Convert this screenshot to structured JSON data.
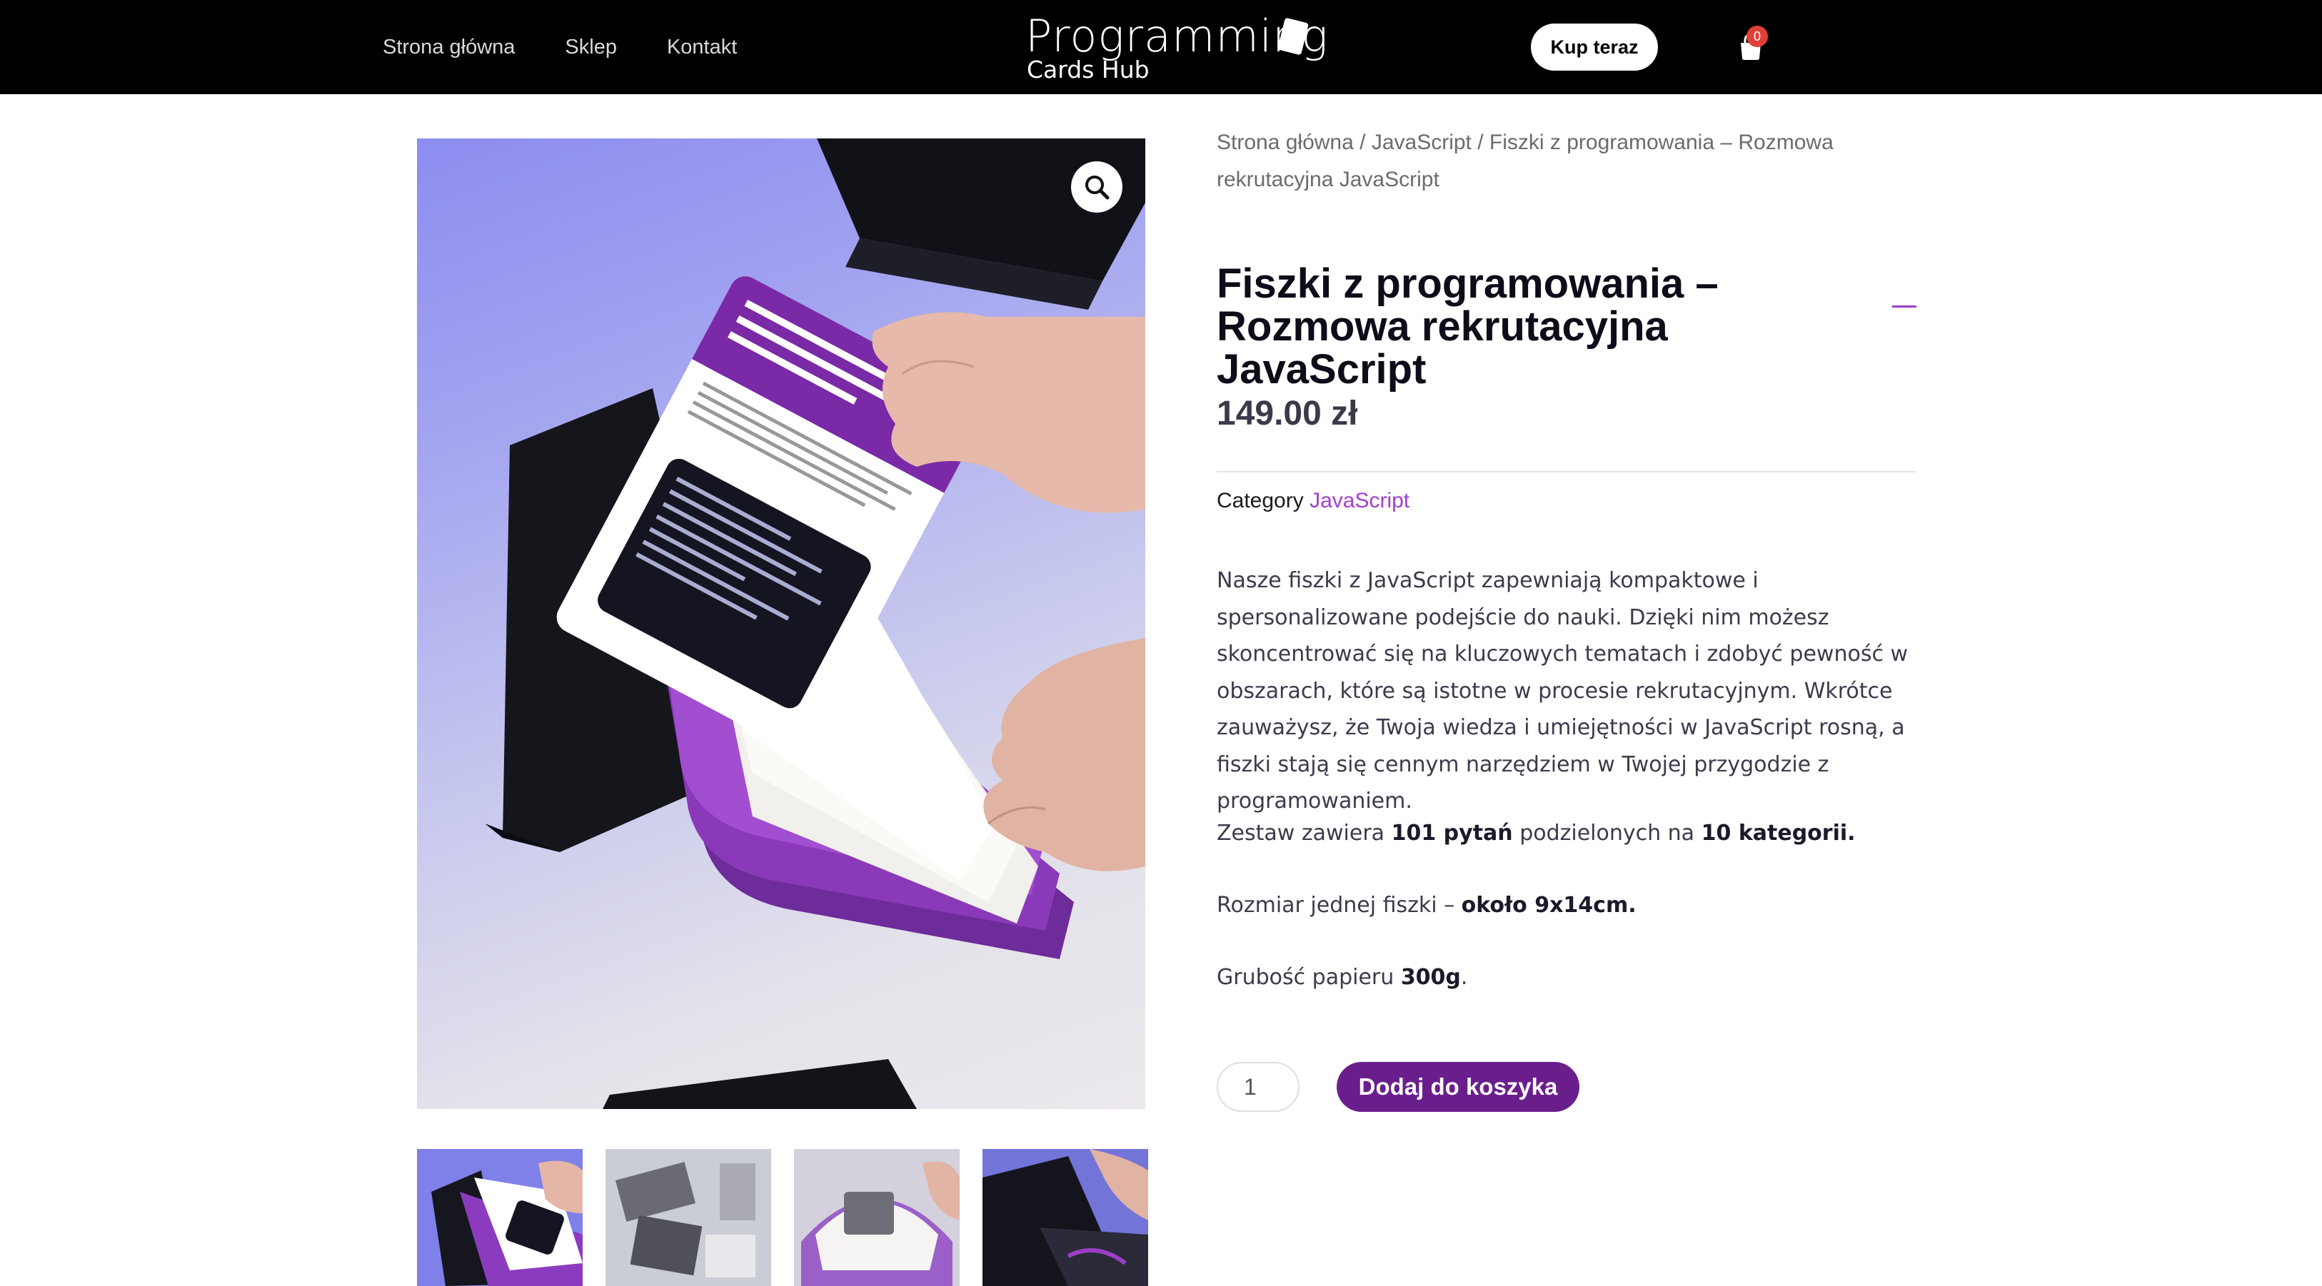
{
  "header": {
    "nav": [
      "Strona główna",
      "Sklep",
      "Kontakt"
    ],
    "logo": {
      "line1": "Programming",
      "line2": "Cards Hub"
    },
    "buy_label": "Kup teraz",
    "cart_count": "0"
  },
  "breadcrumb": {
    "home": "Strona główna",
    "category": "JavaScript",
    "current": "Fiszki z programowania – Rozmowa rekrutacyjna JavaScript",
    "separator": "/"
  },
  "product": {
    "title": "Fiszki z programowania – Rozmowa rekrutacyjna JavaScript",
    "price": "149.00 zł",
    "category_label": "Category",
    "category_value": "JavaScript",
    "description": "Nasze fiszki z JavaScript zapewniają kompaktowe i spersonalizowane podejście do nauki. Dzięki nim możesz skoncentrować się na kluczowych tematach i zdobyć pewność w obszarach, które są istotne w procesie rekrutacyjnym. Wkrótce zauważysz, że Twoja wiedza i umiejętności w JavaScript rosną, a fiszki stają się cennym narzędziem w Twojej przygodzie z programowaniem.",
    "set_prefix": "Zestaw zawiera",
    "set_count": "101 pytań",
    "set_middle": "podzielonych na",
    "set_categories": "10 kategorii.",
    "size_prefix": "Rozmiar jednej fiszki –",
    "size_value": "około 9x14cm.",
    "paper_prefix": "Grubość papieru",
    "paper_value": "300g",
    "paper_suffix": ".",
    "quantity": "1",
    "add_to_cart_label": "Dodaj do koszyka"
  },
  "colors": {
    "header_bg": "#000000",
    "accent_purple": "#6a1e8c",
    "link_purple": "#a03fcf",
    "cart_badge": "#e0403a"
  },
  "icons": [
    "cart-icon",
    "zoom-icon"
  ]
}
